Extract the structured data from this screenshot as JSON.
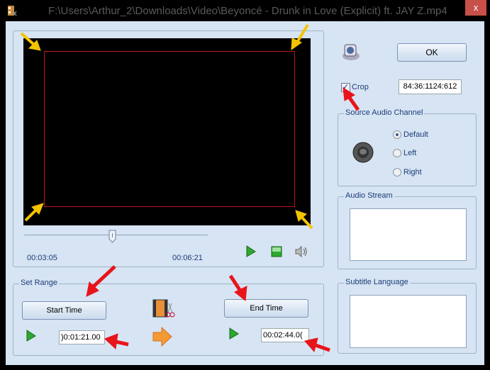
{
  "window": {
    "title": "F:\\Users\\Arthur_2\\Downloads\\Video\\Beyoncé - Drunk in Love (Explicit) ft. JAY Z.mp4",
    "close_label": "x"
  },
  "player": {
    "current_time": "00:03:05",
    "end_time": "00:06:21",
    "slider_position": 0.48
  },
  "right": {
    "ok_label": "OK",
    "crop_label": "Crop",
    "crop_checked": true,
    "crop_value": "84:36:1124:612"
  },
  "audio_channel": {
    "title": "Source Audio Channel",
    "options": [
      "Default",
      "Left",
      "Right"
    ],
    "selected": "Default"
  },
  "audio_stream": {
    "title": "Audio Stream"
  },
  "subtitle": {
    "title": "Subtitle Language"
  },
  "range": {
    "title": "Set Range",
    "start_label": "Start Time",
    "end_label": "End Time",
    "start_value": ")0:01:21.00",
    "end_value": "00:02:44.0("
  },
  "colors": {
    "background": "#d6e4f3",
    "crop_rect": "#c0141e",
    "annotation_yellow": "#f5c400",
    "annotation_red": "#e8141a"
  }
}
